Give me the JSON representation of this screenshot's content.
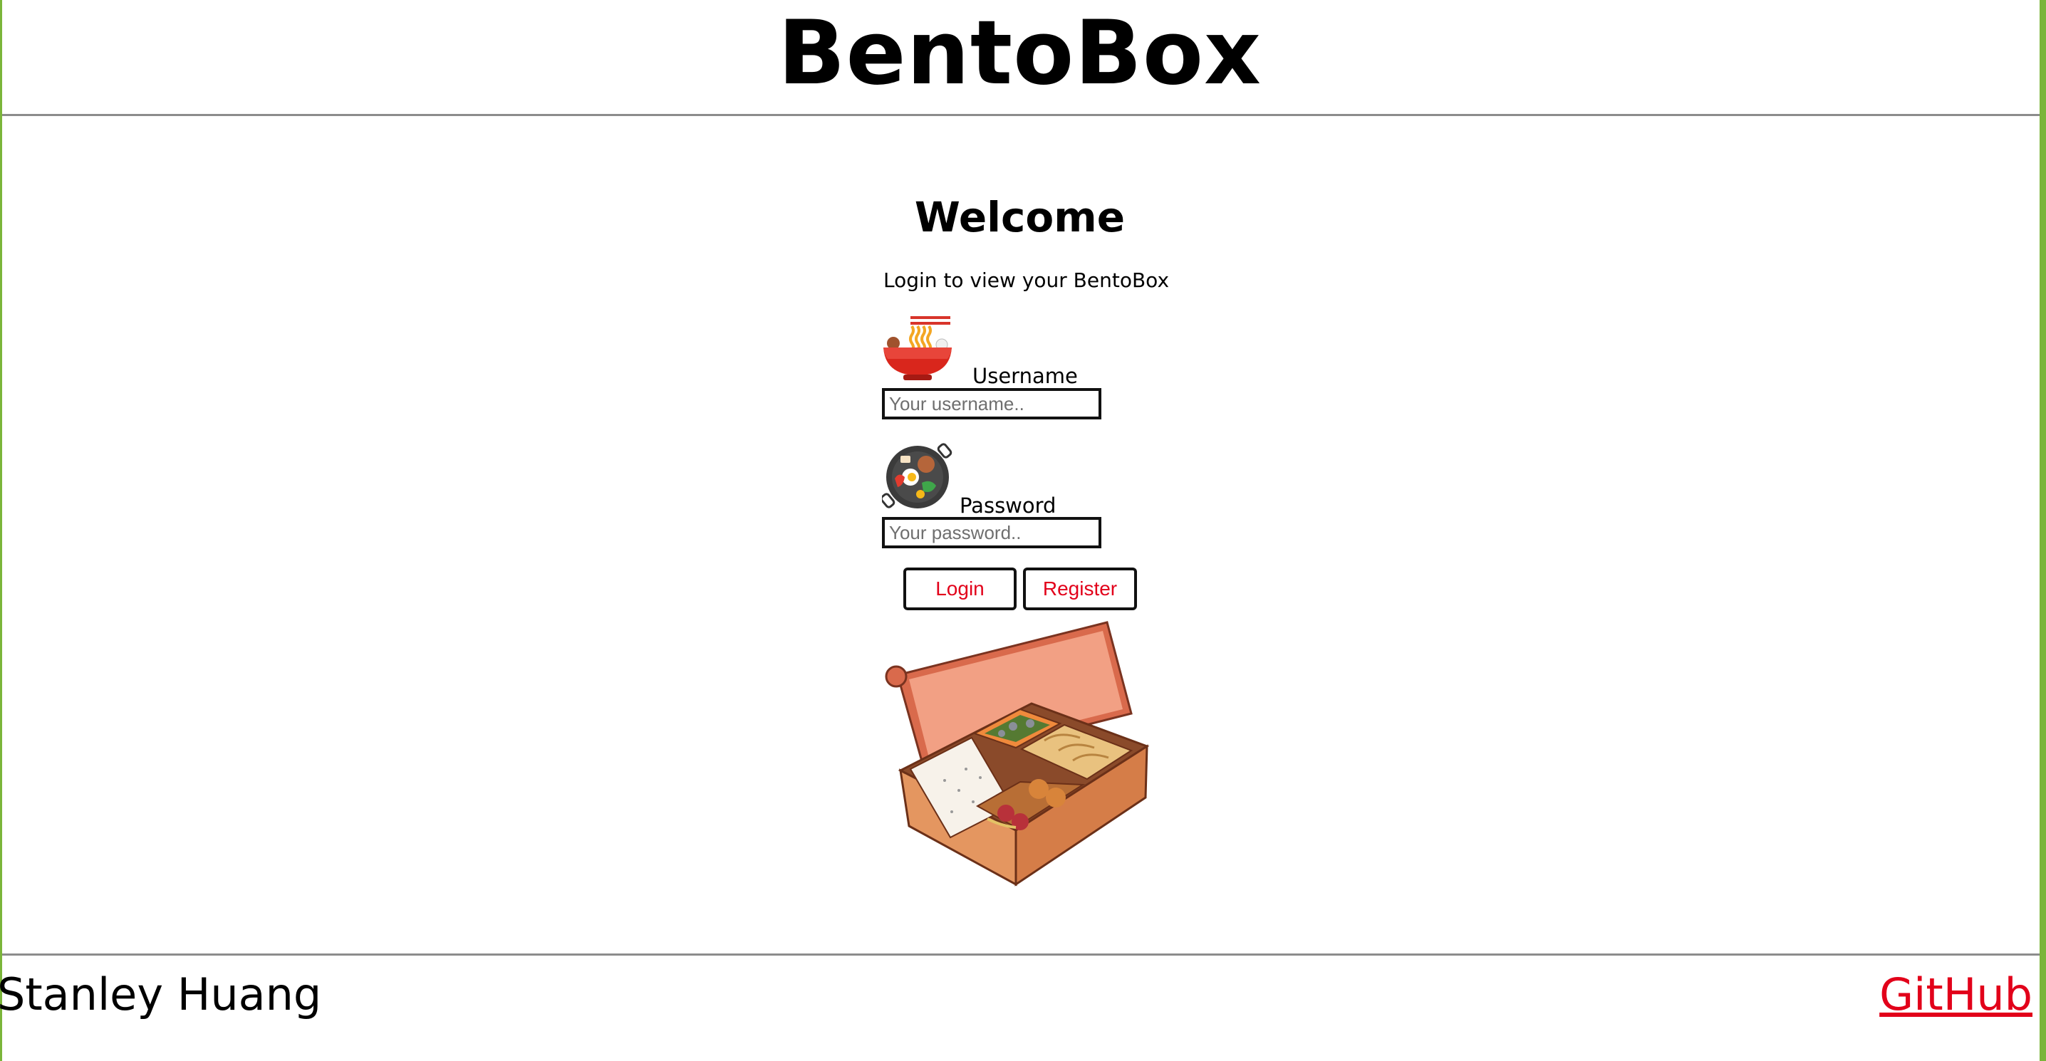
{
  "header": {
    "title": "BentoBox"
  },
  "login": {
    "heading": "Welcome",
    "subtitle": "Login to view your BentoBox",
    "username_label": "Username",
    "username_placeholder": "Your username..",
    "password_label": "Password",
    "password_placeholder": "Your password..",
    "login_button": "Login",
    "register_button": "Register",
    "icons": [
      "ramen-bowl-icon",
      "frying-pan-icon",
      "bento-box-illustration"
    ]
  },
  "footer": {
    "author": "Stanley Huang",
    "github_link": "GitHub"
  },
  "colors": {
    "accent_red": "#e2001a",
    "frame_green": "#7bb53a",
    "rule_gray": "#8c8c8c"
  }
}
